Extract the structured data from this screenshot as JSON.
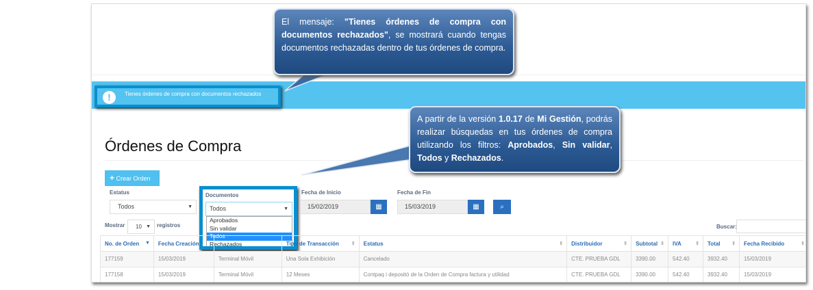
{
  "banner": {
    "text": "Tienes órdenes de compra con documentos rechazados",
    "icon": "exclamation-icon"
  },
  "page": {
    "title": "Órdenes de Compra",
    "create_button": "Crear Orden"
  },
  "filters": {
    "status_label": "Estatus",
    "status_value": "Todos",
    "documents_label": "Documentos",
    "documents_value": "Todos",
    "documents_options": [
      "Aprobados",
      "Sin validar",
      "Todos",
      "Rechazados"
    ],
    "documents_selected": "Todos",
    "start_label": "Fecha de Inicio",
    "start_value": "15/02/2019",
    "end_label": "Fecha de Fin",
    "end_value": "15/03/2019"
  },
  "table_controls": {
    "show": "Mostrar",
    "page_size": "10",
    "records": "registros",
    "search_label": "Buscar:",
    "search_value": ""
  },
  "table": {
    "headers": [
      "No. de Orden",
      "Fecha Creación",
      "",
      "Tipo de Transacción",
      "Estatus",
      "Distribuidor",
      "Subtotal",
      "IVA",
      "Total",
      "Fecha Recibido"
    ],
    "rows": [
      [
        "177159",
        "15/03/2019",
        "Terminal Móvil",
        "Una Sola Exhibición",
        "Cancelado",
        "CTE. PRUEBA GDL",
        "3390.00",
        "542.40",
        "3932.40",
        "15/03/2019"
      ],
      [
        "177158",
        "15/03/2019",
        "Terminal Móvil",
        "12 Meses",
        "Contpaq i depositó de la Orden de Compra factura y utilidad",
        "CTE. PRUEBA GDL",
        "3390.00",
        "542.40",
        "3932.40",
        "15/03/2019"
      ]
    ]
  },
  "callouts": {
    "c1": {
      "t1": "El mensaje: ",
      "b1": "\"Tienes órdenes de compra con documentos rechazados\"",
      "t2": ", se mostrará cuando tengas documentos rechazadas dentro de tus órdenes de compra."
    },
    "c2": {
      "t1": "A partir de la versión ",
      "b1": "1.0.17",
      "t2": " de ",
      "b2": "Mi Gestión",
      "t3": ", podrás realizar búsquedas en tus órdenes de compra utilizando los filtros: ",
      "b3": "Aprobados",
      "t4": ", ",
      "b4": "Sin validar",
      "t5": ", ",
      "b5": "Todos",
      "t6": " y ",
      "b6": "Rechazados",
      "t7": "."
    }
  }
}
